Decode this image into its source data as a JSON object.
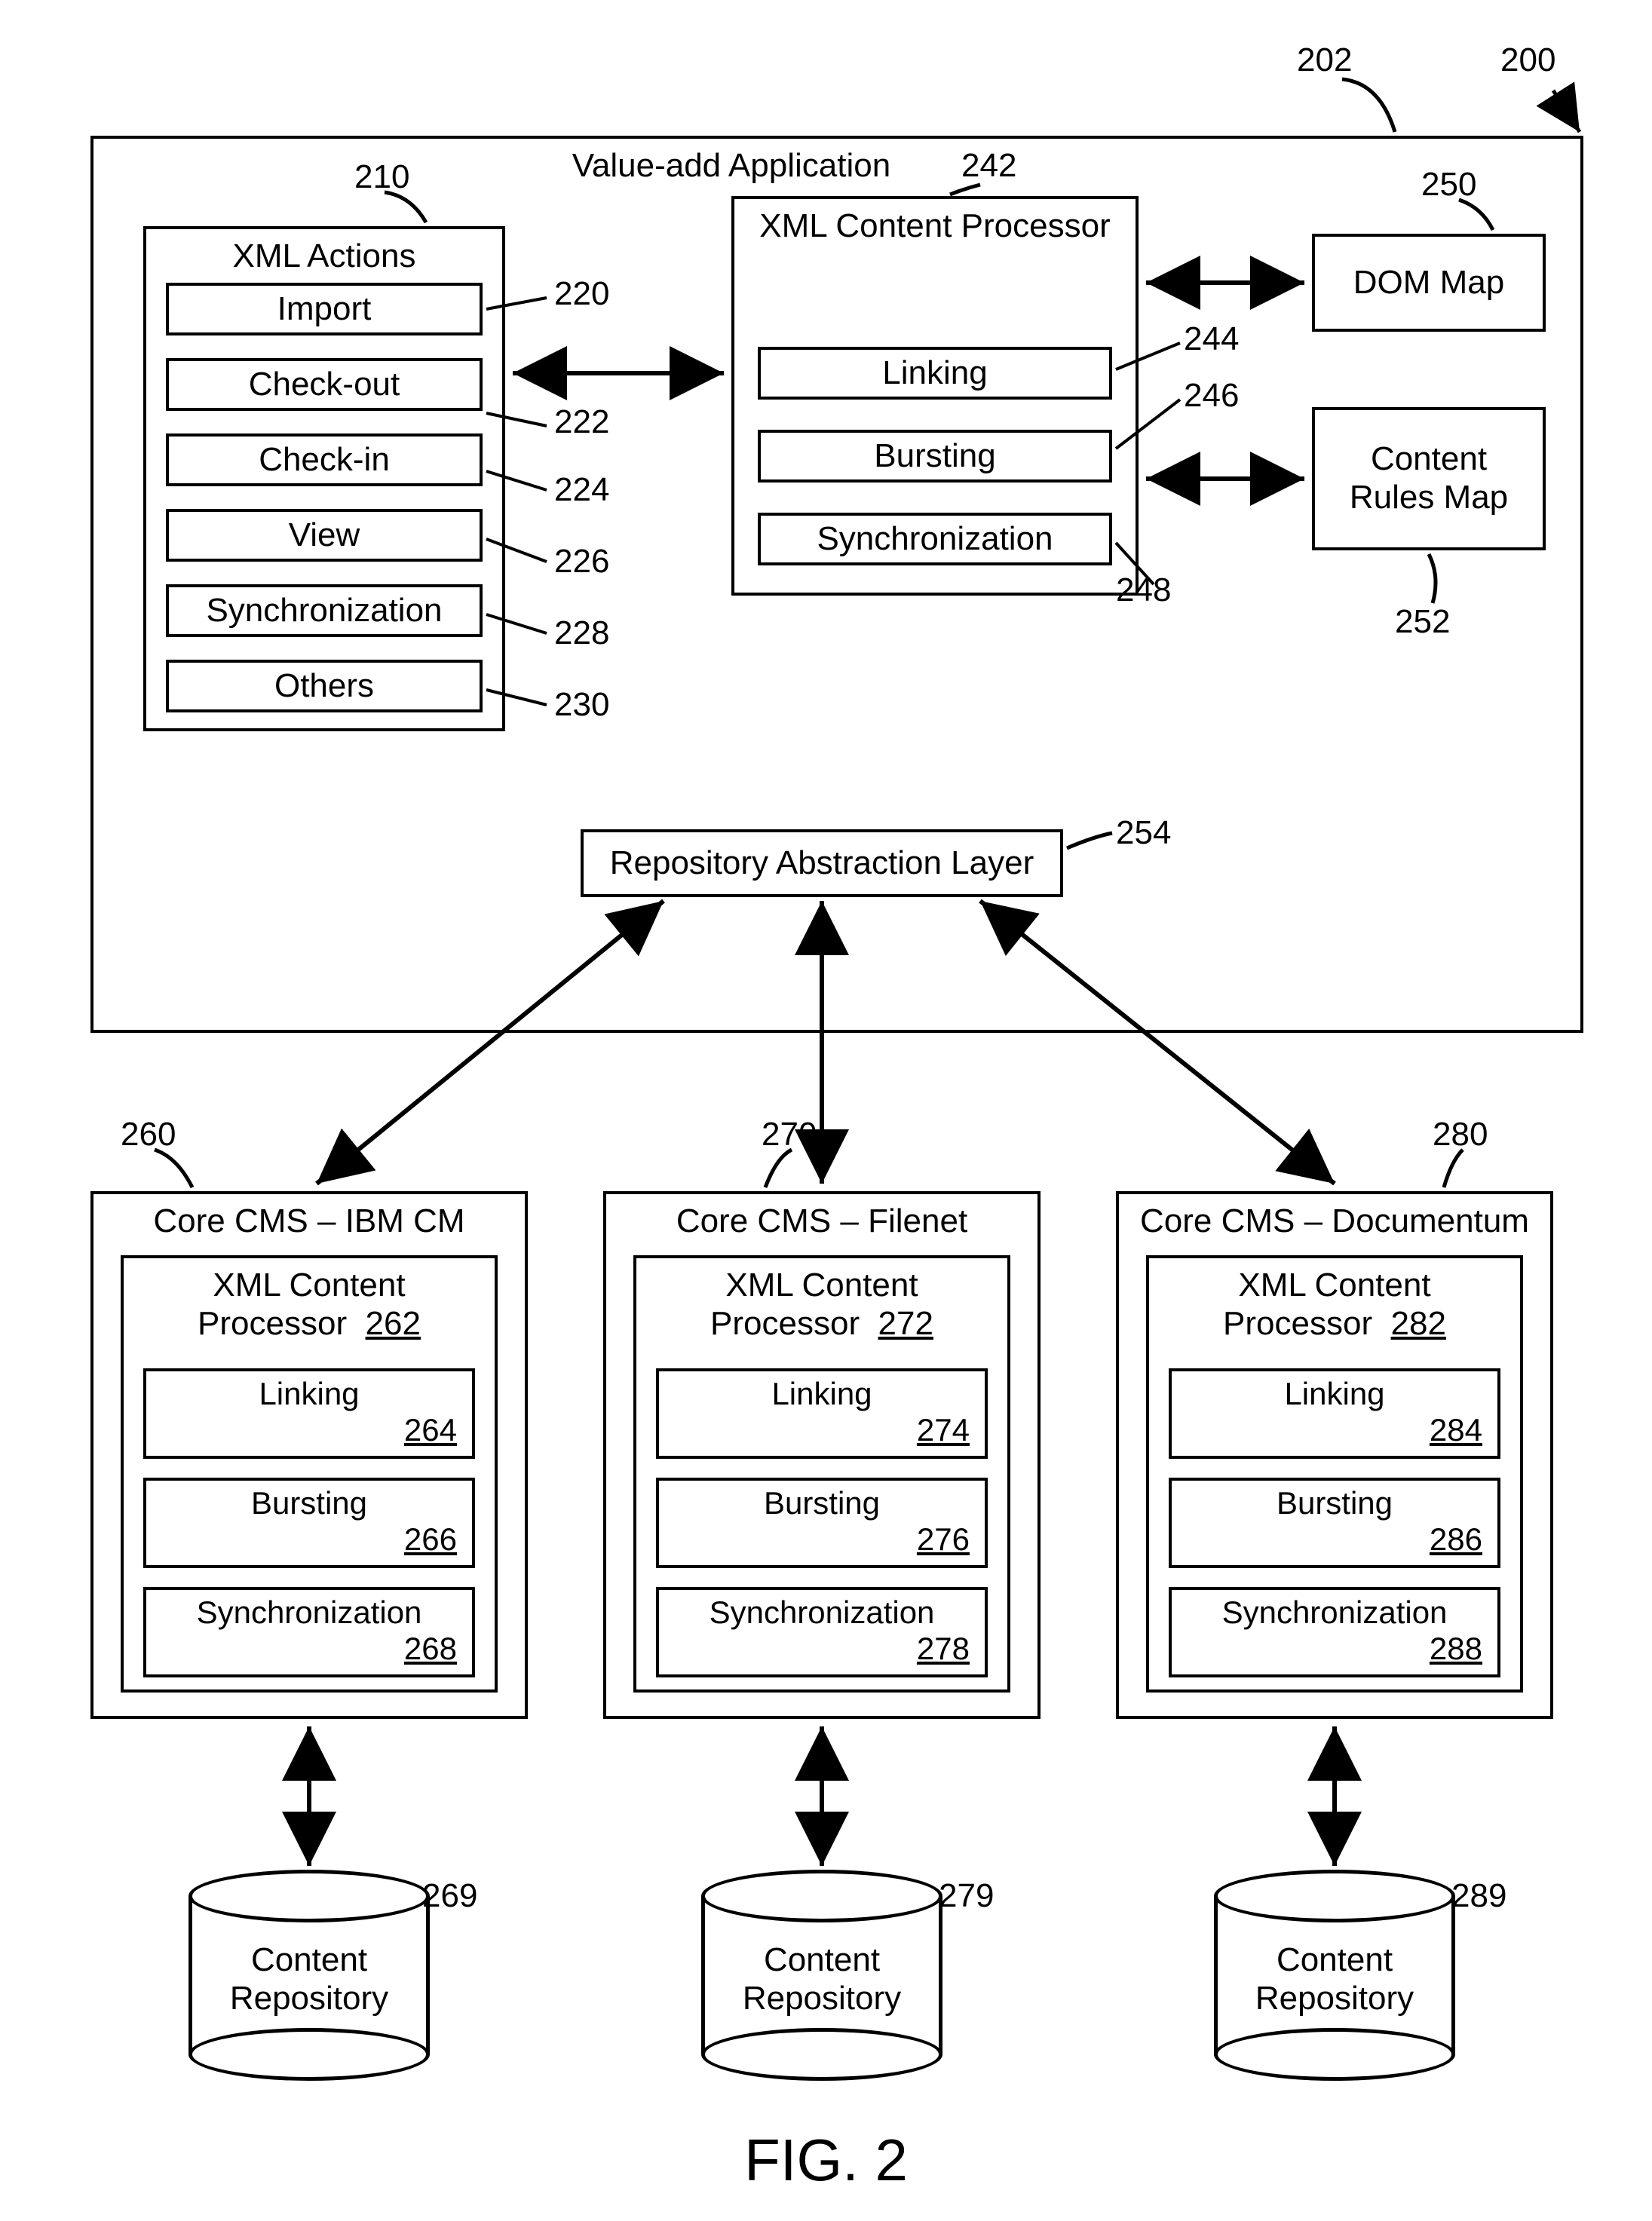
{
  "figure_label": "FIG. 2",
  "refs": {
    "r200": "200",
    "r202": "202",
    "r210": "210",
    "r220": "220",
    "r222": "222",
    "r224": "224",
    "r226": "226",
    "r228": "228",
    "r230": "230",
    "r242": "242",
    "r244": "244",
    "r246": "246",
    "r248": "248",
    "r250": "250",
    "r252": "252",
    "r254": "254",
    "r260": "260",
    "r262": "262",
    "r264": "264",
    "r266": "266",
    "r268": "268",
    "r269": "269",
    "r270": "270",
    "r272": "272",
    "r274": "274",
    "r276": "276",
    "r278": "278",
    "r279": "279",
    "r280": "280",
    "r282": "282",
    "r284": "284",
    "r286": "286",
    "r288": "288",
    "r289": "289"
  },
  "app": {
    "title": "Value-add Application",
    "xml_actions": {
      "title": "XML Actions",
      "items": [
        "Import",
        "Check-out",
        "Check-in",
        "View",
        "Synchronization",
        "Others"
      ]
    },
    "xml_processor": {
      "title": "XML Content Processor",
      "items": [
        "Linking",
        "Bursting",
        "Synchronization"
      ]
    },
    "dom_map": "DOM Map",
    "content_rules": "Content Rules Map",
    "ral": "Repository Abstraction Layer"
  },
  "cms": [
    {
      "title": "Core CMS – IBM CM",
      "proc_label": "XML Content Processor",
      "proc_ref": "262",
      "items": [
        {
          "label": "Linking",
          "ref": "264"
        },
        {
          "label": "Bursting",
          "ref": "266"
        },
        {
          "label": "Synchronization",
          "ref": "268"
        }
      ],
      "repo": "Content Repository"
    },
    {
      "title": "Core CMS – Filenet",
      "proc_label": "XML Content Processor",
      "proc_ref": "272",
      "items": [
        {
          "label": "Linking",
          "ref": "274"
        },
        {
          "label": "Bursting",
          "ref": "276"
        },
        {
          "label": "Synchronization",
          "ref": "278"
        }
      ],
      "repo": "Content Repository"
    },
    {
      "title": "Core CMS – Documentum",
      "proc_label": "XML Content Processor",
      "proc_ref": "282",
      "items": [
        {
          "label": "Linking",
          "ref": "284"
        },
        {
          "label": "Bursting",
          "ref": "286"
        },
        {
          "label": "Synchronization",
          "ref": "288"
        }
      ],
      "repo": "Content Repository"
    }
  ]
}
